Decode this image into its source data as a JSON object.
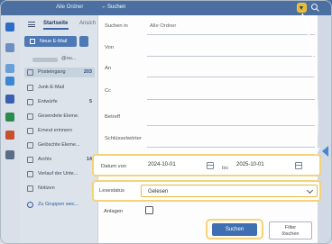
{
  "topbar": {
    "scope_hint": "Alle Ordner",
    "back_glyph": "←",
    "search_label": "Suchen"
  },
  "sidebar": {
    "tab_active": "Startseite",
    "tab_other": "Ansich",
    "new_mail_label": "Neue E-Mail",
    "account_suffix": "@ou...",
    "folders": [
      {
        "label": "Posteingang",
        "count": "203",
        "active": true
      },
      {
        "label": "Junk-E-Mail",
        "count": ""
      },
      {
        "label": "Entwürfe",
        "count": "5"
      },
      {
        "label": "Gesendete Eleme...",
        "count": ""
      },
      {
        "label": "Erneut erinnern",
        "count": ""
      },
      {
        "label": "Gelöschte Eleme...",
        "count": ""
      },
      {
        "label": "Archiv",
        "count": "14"
      },
      {
        "label": "Verlauf der Unte...",
        "count": ""
      },
      {
        "label": "Notizen",
        "count": ""
      }
    ],
    "groups_link": "Zu Gruppen wec..."
  },
  "form": {
    "search_in_label": "Suchen in",
    "search_in_value": "Alle Ordner",
    "from_label": "Von",
    "to_label": "An",
    "cc_label": "Cc",
    "subject_label": "Betreff",
    "keywords_label": "Schlüsselwörter",
    "date_label": "Datum von",
    "date_from": "2024-10-01",
    "date_separator": "bis",
    "date_to": "2025-10-01",
    "read_status_label": "Lesestatus",
    "read_status_value": "Gelesen",
    "attachments_label": "Anlagen",
    "search_button": "Suchen",
    "reset_button_line1": "Filter",
    "reset_button_line2": "löschen"
  },
  "colors": {
    "accent": "#3f6fb3",
    "highlight": "#f3d27a",
    "titlebar": "#4a6fa0"
  }
}
